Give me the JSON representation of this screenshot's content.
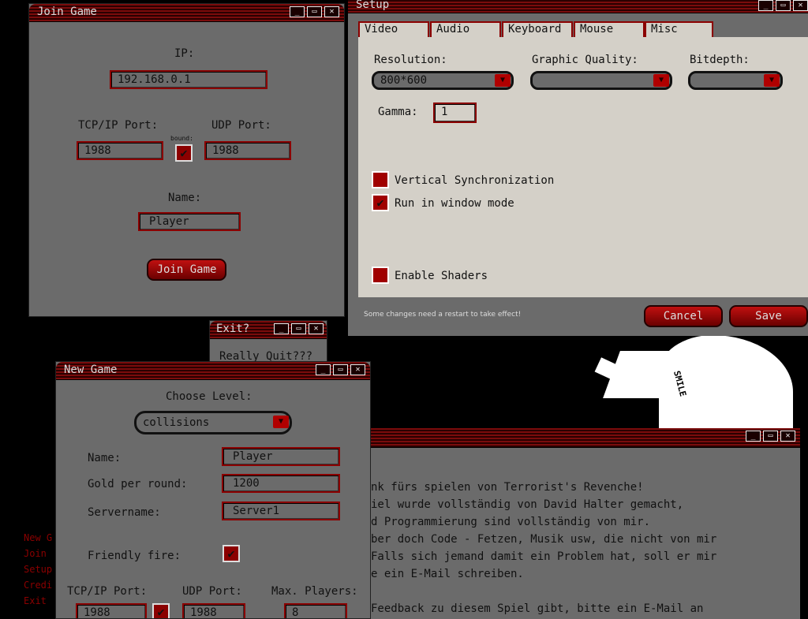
{
  "join_game": {
    "title": "Join Game",
    "ip_label": "IP:",
    "ip_value": "192.168.0.1",
    "tcp_label": "TCP/IP Port:",
    "udp_label": "UDP Port:",
    "bound_label": "bound:",
    "tcp_value": "1988",
    "udp_value": "1988",
    "name_label": "Name:",
    "name_value": "Player",
    "join_button": "Join Game"
  },
  "setup": {
    "title": "Setup",
    "tabs": [
      "Video",
      "Audio",
      "Keyboard",
      "Mouse",
      "Misc"
    ],
    "resolution_label": "Resolution:",
    "resolution_value": "800*600",
    "quality_label": "Graphic Quality:",
    "quality_value": "",
    "bitdepth_label": "Bitdepth:",
    "bitdepth_value": "",
    "gamma_label": "Gamma:",
    "gamma_value": "1",
    "vsync_label": "Vertical Synchronization",
    "window_mode_label": "Run in window mode",
    "shaders_label": "Enable Shaders",
    "restart_note": "Some changes need a restart to take effect!",
    "cancel_button": "Cancel",
    "save_button": "Save"
  },
  "exit_dialog": {
    "title": "Exit?",
    "message": "Really Quit???"
  },
  "new_game": {
    "title": "New Game",
    "choose_level_label": "Choose Level:",
    "level_value": "collisions",
    "name_label": "Name:",
    "name_value": "Player",
    "gold_label": "Gold per round:",
    "gold_value": "1200",
    "servername_label": "Servername:",
    "servername_value": "Server1",
    "friendly_fire_label": "Friendly fire:",
    "tcp_label": "TCP/IP Port:",
    "udp_label": "UDP Port:",
    "max_players_label": "Max. Players:",
    "tcp_value": "1988",
    "udp_value": "1988",
    "max_players_value": "8"
  },
  "main_menu": {
    "items": [
      "New G",
      "Join",
      "Setup",
      "Credi",
      "Exit"
    ]
  },
  "credits": {
    "lines": [
      "nk fürs spielen von Terrorist's Revenche!",
      "iel wurde vollständig von David Halter gemacht,",
      "d Programmierung sind vollständig von mir.",
      "ber doch Code - Fetzen, Musik usw, die nicht von mir",
      "Falls sich jemand damit ein Problem hat, soll er mir",
      "e ein E-Mail schreiben.",
      "Feedback zu diesem Spiel gibt, bitte ein E-Mail an"
    ]
  },
  "background_art": {
    "text": "SMILE"
  },
  "colors": {
    "accent": "#8b0000",
    "window_bg": "#6b6b6b",
    "setup_bg": "#d4d0c8"
  }
}
